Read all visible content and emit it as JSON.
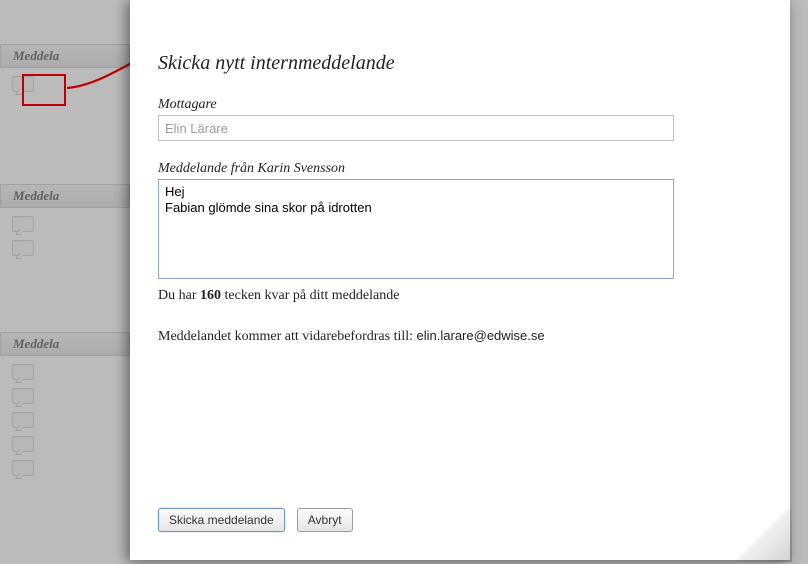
{
  "sidebar": {
    "sections": [
      {
        "label": "Meddela"
      },
      {
        "label": "Meddela"
      },
      {
        "label": "Meddela"
      }
    ]
  },
  "modal": {
    "title": "Skicka nytt internmeddelande",
    "recipient_label": "Mottagare",
    "recipient_value": "Elin Lärare",
    "message_label": "Meddelande från Karin Svensson",
    "message_value": "Hej\nFabian glömde sina skor på idrotten",
    "counter_prefix": "Du har ",
    "counter_value": "160",
    "counter_suffix": " tecken kvar på ditt meddelande",
    "forward_prefix": "Meddelandet kommer att vidarebefordras till: ",
    "forward_email": "elin.larare@edwise.se",
    "send_label": "Skicka meddelande",
    "cancel_label": "Avbryt"
  },
  "annotation": {
    "highlight": "compose-message-icon"
  }
}
